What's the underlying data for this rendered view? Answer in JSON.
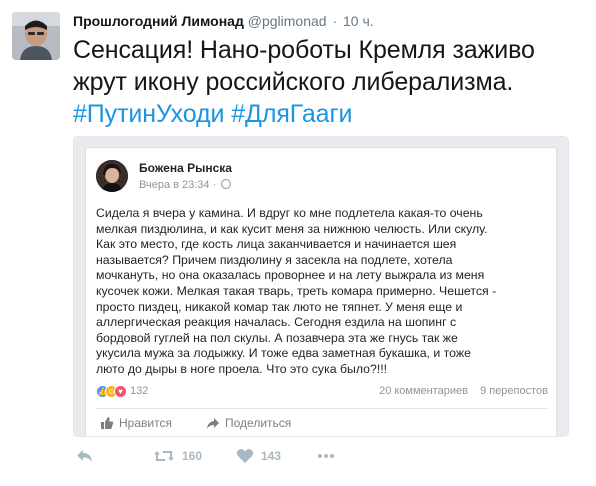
{
  "tweet": {
    "name": "Прошлогодний Лимонад",
    "handle": "@pglimonad",
    "separator": "·",
    "time": "10 ч.",
    "text_line1": "Сенсация! Нано-роботы Кремля заживо",
    "text_line2": "жрут икону российского либерализма.",
    "hashtag1": "#ПутинУходи",
    "hashtag2": "#ДляГааги",
    "hashtag_color": "#1b95e0",
    "avatar_icon": "user-avatar-icon"
  },
  "facebook_post": {
    "author": "Божена Рынска",
    "timestamp": "Вчера в 23:34 ·",
    "privacy_icon": "globe-icon",
    "body_lines": [
      "Сидела я вчера у камина. И вдруг ко мне подлетела какая-то очень",
      "мелкая пиздюлина, и как кусит меня за нижнюю челюсть. Или скулу.",
      "Как это место, где кость лица заканчивается и начинается шея",
      "называется? Причем пиздюлину я засекла на подлете, хотела",
      "мочкануть, но она оказалась проворнее и на лету выжрала из меня",
      "кусочек кожи. Мелкая такая тварь, треть комара примерно. Чешется -",
      "просто пиздец, никакой комар так люто не тяпнет. У меня еще и",
      "аллергическая реакция началась. Сегодня ездила на шопинг с",
      "бордовой гуглей на пол скулы. А позавчера эта же гнусь так же",
      "укусила мужа за лодыжку. И тоже едва заметная букашка, и тоже",
      "люто до дыры в ноге проела. Что это сука было?!!!"
    ],
    "reaction_count": "132",
    "comments": "20 комментариев",
    "shares": "9 перепостов",
    "like_label": "Нравится",
    "share_label": "Поделиться",
    "like_icon": "thumbs-up-icon",
    "share_icon": "share-arrow-icon"
  },
  "actions": {
    "reply_icon": "reply-icon",
    "retweet_icon": "retweet-icon",
    "retweet_count": "160",
    "like_icon": "heart-icon",
    "like_count": "143",
    "more_icon": "more-dots-icon"
  }
}
